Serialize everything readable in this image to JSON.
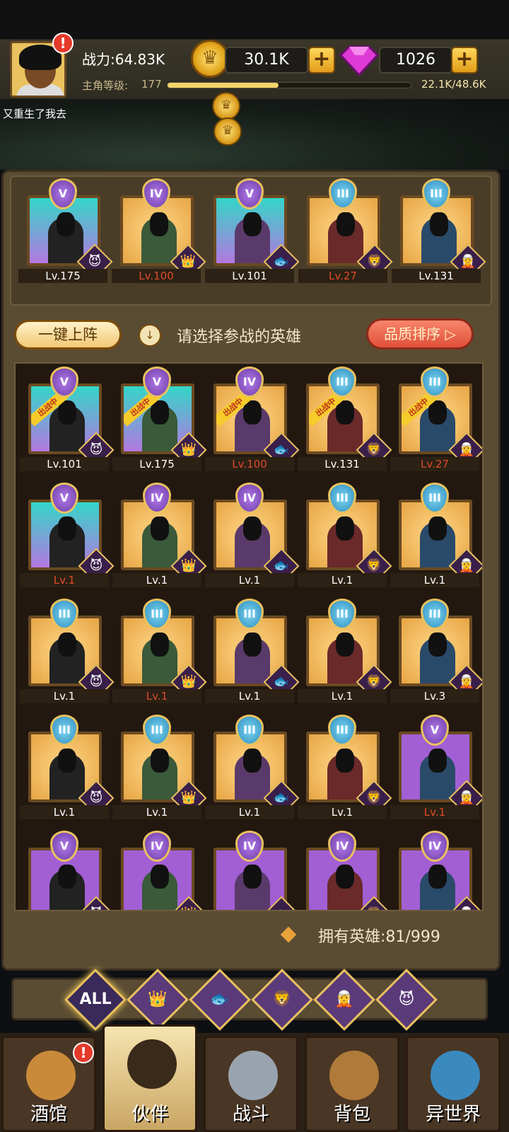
{
  "header": {
    "power_label": "战力:64.83K",
    "gold": "30.1K",
    "gems": "1026",
    "level_label": "主角等级:",
    "level_value": "177",
    "xp_text": "22.1K/48.6K",
    "xp_fraction": 0.455,
    "alert_mark": "!"
  },
  "chat_line": "又重生了我去",
  "team": [
    {
      "tier": "V",
      "level": "Lv.175",
      "bg": "cyan",
      "lvl_red": false
    },
    {
      "tier": "IV",
      "level": "Lv.100",
      "bg": "gold",
      "lvl_red": true
    },
    {
      "tier": "V",
      "level": "Lv.101",
      "bg": "cyan",
      "lvl_red": false
    },
    {
      "tier": "III",
      "level": "Lv.27",
      "bg": "gold",
      "lvl_red": true
    },
    {
      "tier": "III",
      "level": "Lv.131",
      "bg": "gold",
      "lvl_red": false
    }
  ],
  "controls": {
    "one_key_label": "一键上阵",
    "hint": "请选择参战的英雄",
    "sort_label": "品质排序 ▷"
  },
  "deployed_tag": "出战中",
  "heroes": [
    {
      "tier": "V",
      "level": "Lv.101",
      "bg": "cyan",
      "red": false,
      "deployed": true
    },
    {
      "tier": "V",
      "level": "Lv.175",
      "bg": "cyan",
      "red": false,
      "deployed": true
    },
    {
      "tier": "IV",
      "level": "Lv.100",
      "bg": "gold",
      "red": true,
      "deployed": true
    },
    {
      "tier": "III",
      "level": "Lv.131",
      "bg": "gold",
      "red": false,
      "deployed": true
    },
    {
      "tier": "III",
      "level": "Lv.27",
      "bg": "gold",
      "red": true,
      "deployed": true
    },
    {
      "tier": "V",
      "level": "Lv.1",
      "bg": "cyan",
      "red": true,
      "deployed": false
    },
    {
      "tier": "IV",
      "level": "Lv.1",
      "bg": "gold",
      "red": false,
      "deployed": false
    },
    {
      "tier": "IV",
      "level": "Lv.1",
      "bg": "gold",
      "red": false,
      "deployed": false
    },
    {
      "tier": "III",
      "level": "Lv.1",
      "bg": "gold",
      "red": false,
      "deployed": false
    },
    {
      "tier": "III",
      "level": "Lv.1",
      "bg": "gold",
      "red": false,
      "deployed": false
    },
    {
      "tier": "III",
      "level": "Lv.1",
      "bg": "gold",
      "red": false,
      "deployed": false
    },
    {
      "tier": "III",
      "level": "Lv.1",
      "bg": "gold",
      "red": true,
      "deployed": false
    },
    {
      "tier": "III",
      "level": "Lv.1",
      "bg": "gold",
      "red": false,
      "deployed": false
    },
    {
      "tier": "III",
      "level": "Lv.1",
      "bg": "gold",
      "red": false,
      "deployed": false
    },
    {
      "tier": "III",
      "level": "Lv.3",
      "bg": "gold",
      "red": false,
      "deployed": false
    },
    {
      "tier": "III",
      "level": "Lv.1",
      "bg": "gold",
      "red": false,
      "deployed": false
    },
    {
      "tier": "III",
      "level": "Lv.1",
      "bg": "gold",
      "red": false,
      "deployed": false
    },
    {
      "tier": "III",
      "level": "Lv.1",
      "bg": "gold",
      "red": false,
      "deployed": false
    },
    {
      "tier": "III",
      "level": "Lv.1",
      "bg": "gold",
      "red": false,
      "deployed": false
    },
    {
      "tier": "V",
      "level": "Lv.1",
      "bg": "purple",
      "red": true,
      "deployed": false
    },
    {
      "tier": "V",
      "level": "",
      "bg": "purple",
      "red": false,
      "deployed": false
    },
    {
      "tier": "IV",
      "level": "",
      "bg": "purple",
      "red": false,
      "deployed": false
    },
    {
      "tier": "IV",
      "level": "",
      "bg": "purple",
      "red": false,
      "deployed": false
    },
    {
      "tier": "IV",
      "level": "",
      "bg": "purple",
      "red": false,
      "deployed": false
    },
    {
      "tier": "IV",
      "level": "",
      "bg": "purple",
      "red": false,
      "deployed": false
    }
  ],
  "owned_heroes": "拥有英雄:81/999",
  "filters": [
    "ALL",
    "crown-icon",
    "fish-icon",
    "lion-icon",
    "elf-icon",
    "demon-icon"
  ],
  "nav": [
    {
      "label": "酒馆",
      "active": false,
      "icon": "beer-mug-icon",
      "alert": true
    },
    {
      "label": "伙伴",
      "active": true,
      "icon": "partner-avatar-icon",
      "alert": false
    },
    {
      "label": "战斗",
      "active": false,
      "icon": "crossed-swords-icon",
      "alert": false
    },
    {
      "label": "背包",
      "active": false,
      "icon": "backpack-icon",
      "alert": false
    },
    {
      "label": "异世界",
      "active": false,
      "icon": "portal-icon",
      "alert": false
    }
  ],
  "colors": {
    "gold": "#e9c25f",
    "alert": "#e53a2a",
    "red_level": "#e04a2a",
    "panel": "#5a4b33"
  }
}
